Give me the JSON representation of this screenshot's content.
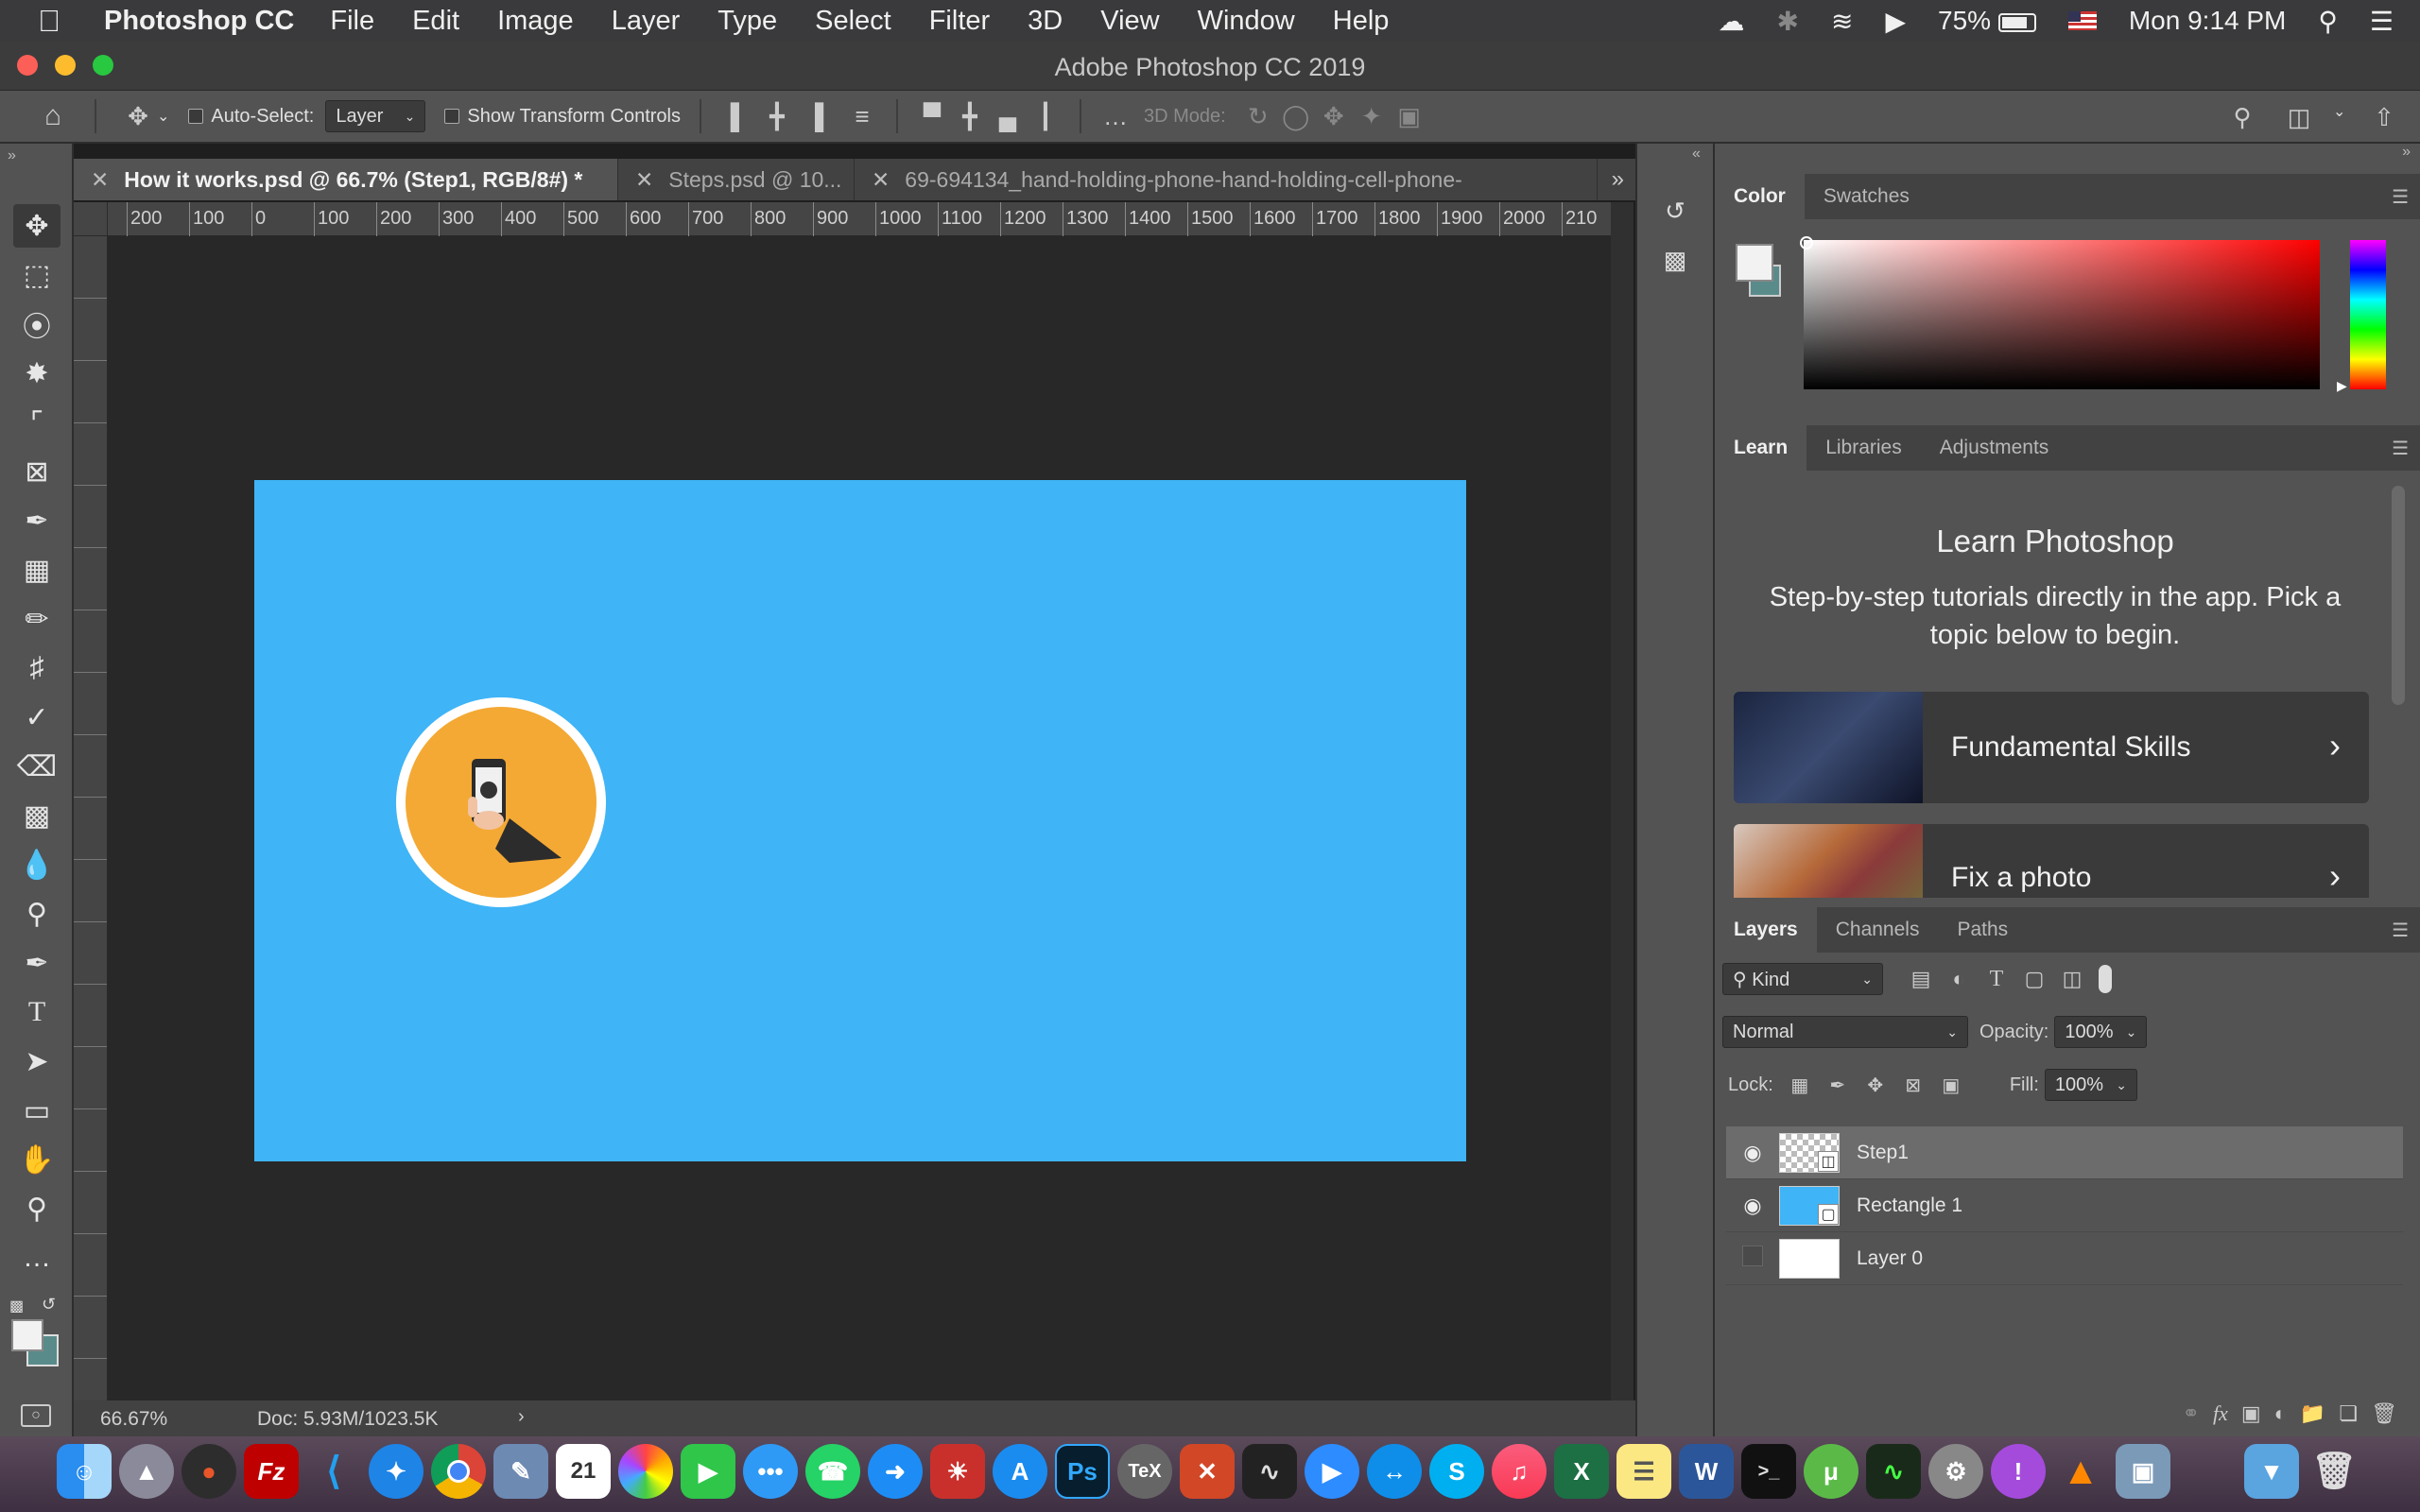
{
  "menubar": {
    "app_name": "Photoshop CC",
    "menus": [
      "File",
      "Edit",
      "Image",
      "Layer",
      "Type",
      "Select",
      "Filter",
      "3D",
      "View",
      "Window",
      "Help"
    ],
    "battery": "75%",
    "clock": "Mon 9:14 PM"
  },
  "window": {
    "title": "Adobe Photoshop CC 2019"
  },
  "options": {
    "auto_select_label": "Auto-Select:",
    "auto_select_value": "Layer",
    "transform_label": "Show Transform Controls",
    "mode_3d_label": "3D Mode:"
  },
  "tabs": [
    {
      "label": "How it works.psd @ 66.7% (Step1, RGB/8#) *"
    },
    {
      "label": "Steps.psd @ 10..."
    },
    {
      "label": "69-694134_hand-holding-phone-hand-holding-cell-phone-"
    }
  ],
  "ruler_top": [
    "200",
    "100",
    "0",
    "100",
    "200",
    "300",
    "400",
    "500",
    "600",
    "700",
    "800",
    "900",
    "1000",
    "1100",
    "1200",
    "1300",
    "1400",
    "1500",
    "1600",
    "1700",
    "1800",
    "1900",
    "2000",
    "210"
  ],
  "status": {
    "zoom": "66.67%",
    "doc": "Doc: 5.93M/1023.5K"
  },
  "color_panel": {
    "tabs": [
      "Color",
      "Swatches"
    ]
  },
  "learn_panel": {
    "tabs": [
      "Learn",
      "Libraries",
      "Adjustments"
    ],
    "title": "Learn Photoshop",
    "description": "Step-by-step tutorials directly in the app. Pick a topic below to begin.",
    "cards": [
      {
        "label": "Fundamental Skills"
      },
      {
        "label": "Fix a photo"
      }
    ]
  },
  "layers_panel": {
    "tabs": [
      "Layers",
      "Channels",
      "Paths"
    ],
    "filter_label": "Kind",
    "blend_mode": "Normal",
    "opacity_label": "Opacity:",
    "opacity_value": "100%",
    "lock_label": "Lock:",
    "fill_label": "Fill:",
    "fill_value": "100%",
    "layers": [
      {
        "name": "Step1",
        "visible": true,
        "selected": true
      },
      {
        "name": "Rectangle 1",
        "visible": true,
        "selected": false
      },
      {
        "name": "Layer 0",
        "visible": false,
        "selected": false
      }
    ]
  },
  "colors": {
    "canvas_blue": "#3fb4f6",
    "badge_orange": "#f4a934"
  }
}
